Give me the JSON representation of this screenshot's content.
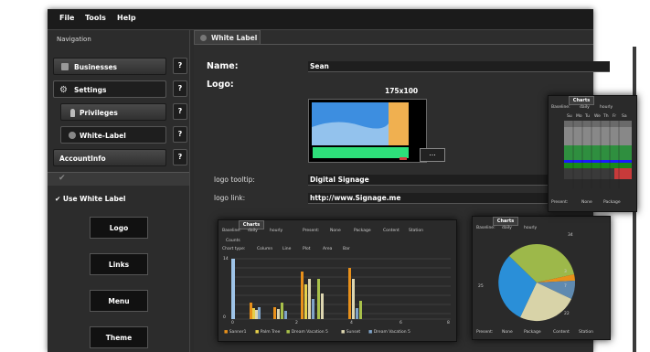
{
  "menu": [
    "File",
    "Tools",
    "Help"
  ],
  "nav": {
    "title": "Navigation",
    "items": [
      {
        "label": "Businesses",
        "help": "?"
      },
      {
        "label": "Settings",
        "help": "?"
      },
      {
        "label": "Privileges",
        "help": "?"
      },
      {
        "label": "White-Label",
        "help": "?"
      },
      {
        "label": "AccountInfo",
        "help": "?"
      }
    ]
  },
  "left": {
    "use_white_label": "Use White Label",
    "buttons": [
      "Logo",
      "Links",
      "Menu",
      "Theme"
    ]
  },
  "main": {
    "tab": "White Label",
    "name_label": "Name:",
    "name_value": "Sean",
    "logo_label": "Logo:",
    "logo_dims": "175x100",
    "browse_button": "...",
    "tooltip_label": "logo tooltip:",
    "tooltip_value": "Digital Signage",
    "link_label": "logo link:",
    "link_value": "http://www.Signage.me"
  },
  "charts": {
    "tab": "Charts",
    "baseline_label": "Baseline:",
    "baseline_opts": [
      "daily",
      "hourly"
    ],
    "present_label": "Present:",
    "present_opts": [
      "None",
      "Package",
      "Content",
      "Station"
    ],
    "counts": "Counts",
    "chart_type_label": "Chart type:",
    "chart_type_opts": [
      "Column",
      "Line",
      "Plot",
      "Area",
      "Bar"
    ],
    "legend": [
      "Sanner1",
      "Palm Tree",
      "Dream Vacation 5",
      "Sunset",
      "Dream Vacation 5"
    ],
    "x_ticks": [
      "0",
      "2",
      "4",
      "6",
      "8"
    ],
    "y_ticks": [
      "14",
      "12",
      "10",
      "8",
      "6",
      "4",
      "2",
      "0"
    ],
    "pie_labels": [
      "34",
      "3",
      "7",
      "22",
      "25"
    ],
    "table_days": [
      "Su",
      "Mo",
      "Tu",
      "We",
      "Th",
      "Fr",
      "Sa"
    ],
    "table_present": "Present:",
    "table_present_opts": [
      "None",
      "Package"
    ]
  },
  "colors": {
    "bar_orange": "#e8901a",
    "bar_yellow": "#e6cf4a",
    "bar_green": "#a8c04a",
    "bar_beige": "#ddd6b0",
    "bar_blue": "#7fa3c8",
    "pie_green": "#9db84a",
    "pie_blue": "#2a8fd8",
    "pie_beige": "#d8d3a8",
    "pie_orange": "#e8901a",
    "pie_steel": "#5f8ab0"
  }
}
